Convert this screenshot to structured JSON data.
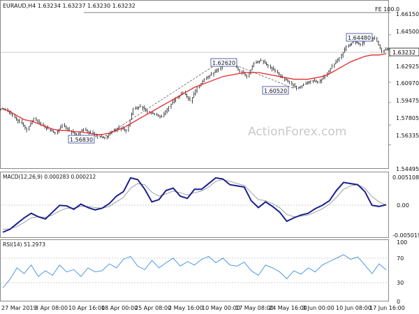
{
  "header": {
    "symbol_line": "EURAUD,H4  1.63234 1.63237 1.63230 1.63232"
  },
  "watermark": "ActionForex.com",
  "fibo_label": "FE 100.0",
  "price_axis": {
    "ticks": [
      "1.66150",
      "1.64500",
      "1.62925",
      "1.60970",
      "1.59475",
      "1.57805",
      "1.56335",
      "1.54495"
    ],
    "current_price": "1.63232"
  },
  "annotations": [
    "1.64480",
    "1.62620",
    "1.60520",
    "1.56830"
  ],
  "macd": {
    "title": "MACD(12,26,9) 0.000283 0.000212",
    "ticks": [
      "0.005108",
      "0.00",
      "-0.005019"
    ]
  },
  "rsi": {
    "title": "RSI(14) 51.2973",
    "ticks": [
      "100",
      "70",
      "30",
      "0"
    ]
  },
  "time_axis": [
    "27 Mar 2019",
    "3 Apr 08:00",
    "10 Apr 16:00",
    "18 Apr 00:00",
    "25 Apr 08:00",
    "2 May 16:00",
    "10 May 00:00",
    "17 May 08:00",
    "24 May 16:00",
    "3 Jun 00:00",
    "10 Jun 08:00",
    "17 Jun 16:00"
  ],
  "colors": {
    "price_bars": "#1a1a1a",
    "moving_average": "#e8262b",
    "macd_line": "#1a1f8c",
    "signal_line": "#9aa0a8",
    "rsi_line": "#3c8ede",
    "grid": "#cfcfcf"
  },
  "chart_data": [
    {
      "type": "ohlc",
      "series": [
        {
          "close": [
            1.59,
            1.585,
            1.58,
            1.575,
            1.583,
            1.578,
            1.575,
            1.572,
            1.578,
            1.574,
            1.571,
            1.575,
            1.572,
            1.57,
            1.5683,
            1.573,
            1.576,
            1.574,
            1.59,
            1.592,
            1.588,
            1.586,
            1.584,
            1.592,
            1.598,
            1.602,
            1.596,
            1.606,
            1.612,
            1.616,
            1.62,
            1.626,
            1.624,
            1.618,
            1.614,
            1.624,
            1.626,
            1.622,
            1.618,
            1.613,
            1.61,
            1.6052,
            1.608,
            1.611,
            1.61,
            1.614,
            1.622,
            1.628,
            1.636,
            1.64,
            1.638,
            1.644,
            1.642,
            1.633,
            1.635
          ]
        },
        {
          "name": "",
          "values": [
            1.59,
            1.588,
            1.585,
            1.582,
            1.581,
            1.579,
            1.577,
            1.575,
            1.574,
            1.574,
            1.573,
            1.573,
            1.572,
            1.571,
            1.571,
            1.572,
            1.574,
            1.576,
            1.579,
            1.582,
            1.585,
            1.588,
            1.591,
            1.594,
            1.597,
            1.6,
            1.603,
            1.606,
            1.608,
            1.61,
            1.612,
            1.614,
            1.615,
            1.616,
            1.617,
            1.617,
            1.617,
            1.616,
            1.615,
            1.614,
            1.613,
            1.612,
            1.612,
            1.612,
            1.613,
            1.614,
            1.616,
            1.619,
            1.622,
            1.625,
            1.627,
            1.629,
            1.63,
            1.63,
            1.631
          ]
        }
      ],
      "annotations": {
        "swing_high": 1.6448,
        "high_1": 1.6262,
        "low_1": 1.6052,
        "swing_low": 1.5683
      },
      "y_range": [
        1.54495,
        1.6615
      ],
      "fe_100": 1.6615
    },
    {
      "type": "line",
      "title": "MACD(12,26,9) 0.000283 0.000212",
      "series": [
        {
          "values": [
            -0.0045,
            -0.004,
            -0.003,
            -0.002,
            -0.0012,
            -0.0018,
            -0.0022,
            -0.001,
            0.0002,
            0.0001,
            -0.0005,
            0.0004,
            -0.0002,
            -0.0006,
            -0.0003,
            0.0005,
            0.0018,
            0.0026,
            0.005,
            0.0047,
            0.003,
            0.0008,
            0.0012,
            0.0028,
            0.0032,
            0.0018,
            0.0014,
            0.003,
            0.003,
            0.004,
            0.005,
            0.0048,
            0.0038,
            0.0036,
            0.0034,
            0.001,
            -0.0002,
            0.0008,
            0.0,
            -0.001,
            -0.0026,
            -0.002,
            -0.0015,
            -0.0012,
            -0.0004,
            0.0002,
            0.001,
            0.0028,
            0.0042,
            0.004,
            0.0038,
            0.0026,
            0.0002,
            0.0,
            0.0003
          ]
        },
        {
          "values": [
            -0.004,
            -0.0039,
            -0.0035,
            -0.0028,
            -0.002,
            -0.0018,
            -0.0019,
            -0.0015,
            -0.0008,
            -0.0003,
            -0.0003,
            0.0,
            0.0,
            -0.0002,
            -0.0003,
            0.0,
            0.0008,
            0.0016,
            0.0032,
            0.004,
            0.0038,
            0.0025,
            0.0018,
            0.0022,
            0.0027,
            0.0024,
            0.002,
            0.0024,
            0.0027,
            0.0034,
            0.0044,
            0.0047,
            0.0044,
            0.004,
            0.0037,
            0.0024,
            0.0012,
            0.001,
            0.0005,
            -0.0002,
            -0.0014,
            -0.0018,
            -0.0017,
            -0.0015,
            -0.001,
            -0.0004,
            0.0004,
            0.0016,
            0.003,
            0.0036,
            0.0038,
            0.0032,
            0.0017,
            0.0008,
            0.0002
          ]
        }
      ],
      "ylim": [
        -0.005019,
        0.005108
      ]
    },
    {
      "type": "line",
      "title": "RSI(14) 51.2973",
      "series": [
        {
          "values": [
            20,
            35,
            55,
            45,
            60,
            40,
            50,
            42,
            60,
            48,
            52,
            40,
            55,
            48,
            50,
            62,
            55,
            70,
            75,
            58,
            52,
            68,
            55,
            64,
            72,
            58,
            66,
            60,
            70,
            75,
            64,
            72,
            60,
            58,
            65,
            50,
            42,
            60,
            55,
            48,
            36,
            50,
            44,
            55,
            48,
            60,
            66,
            72,
            78,
            70,
            74,
            60,
            45,
            62,
            51.3
          ]
        }
      ],
      "ylim": [
        0,
        100
      ]
    }
  ]
}
